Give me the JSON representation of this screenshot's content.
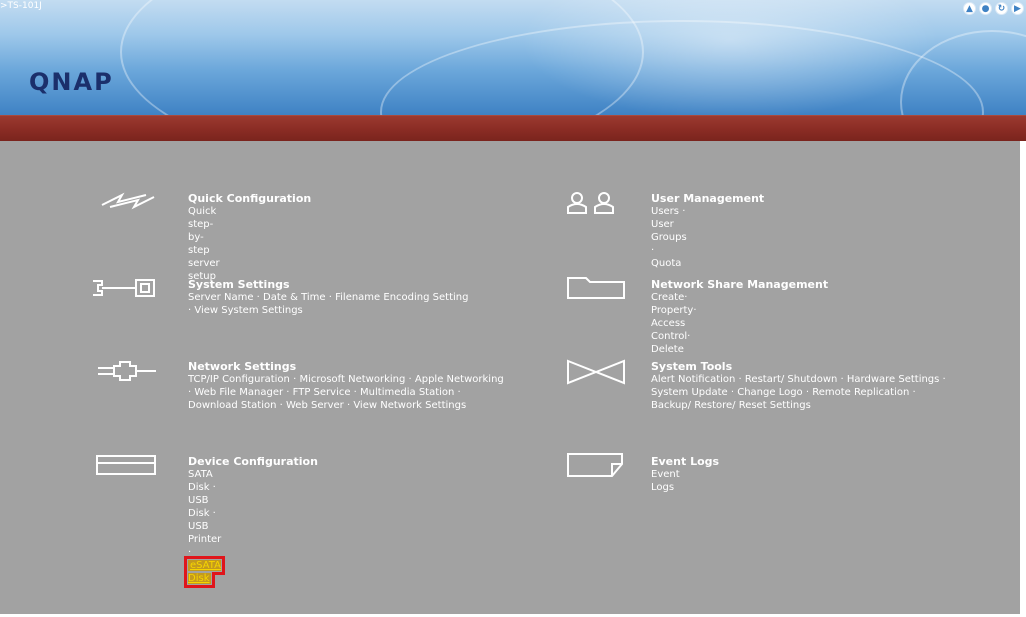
{
  "header": {
    "device_label": ">TS-101J",
    "logo": "QNAP",
    "icons": [
      "home-icon",
      "help-icon",
      "support-icon",
      "logout-icon"
    ]
  },
  "menu": {
    "quick_config": {
      "title": "Quick Configuration",
      "desc": "Quick step-by-step server setup"
    },
    "user_mgmt": {
      "title": "User Management",
      "links": [
        "Users",
        "User Groups",
        "Quota"
      ]
    },
    "system_settings": {
      "title": "System Settings",
      "links": [
        "Server Name",
        "Date & Time",
        "Filename Encoding Setting",
        "View System Settings"
      ]
    },
    "share_mgmt": {
      "title": "Network Share Management",
      "links": [
        "Create",
        "Property",
        "Access Control",
        "Delete"
      ]
    },
    "network_settings": {
      "title": "Network Settings",
      "links": [
        "TCP/IP Configuration",
        "Microsoft Networking",
        "Apple Networking",
        "Web File Manager",
        "FTP Service",
        "Multimedia Station",
        "Download Station",
        "Web Server",
        "View Network Settings"
      ]
    },
    "system_tools": {
      "title": "System Tools",
      "links": [
        "Alert Notification",
        "Restart/ Shutdown",
        "Hardware Settings",
        "System Update",
        "Change Logo",
        "Remote Replication",
        "Backup/ Restore/ Reset Settings"
      ]
    },
    "device_config": {
      "title": "Device Configuration",
      "links": [
        "SATA Disk",
        "USB Disk",
        "USB Printer",
        "eSATA Disk"
      ]
    },
    "event_logs": {
      "title": "Event Logs",
      "links": [
        "Event Logs"
      ]
    }
  },
  "colors": {
    "header_blue": "#6aa6da",
    "red_bar": "#8a2c24",
    "content_gray": "#a2a2a2",
    "highlight": "#e0151b"
  }
}
